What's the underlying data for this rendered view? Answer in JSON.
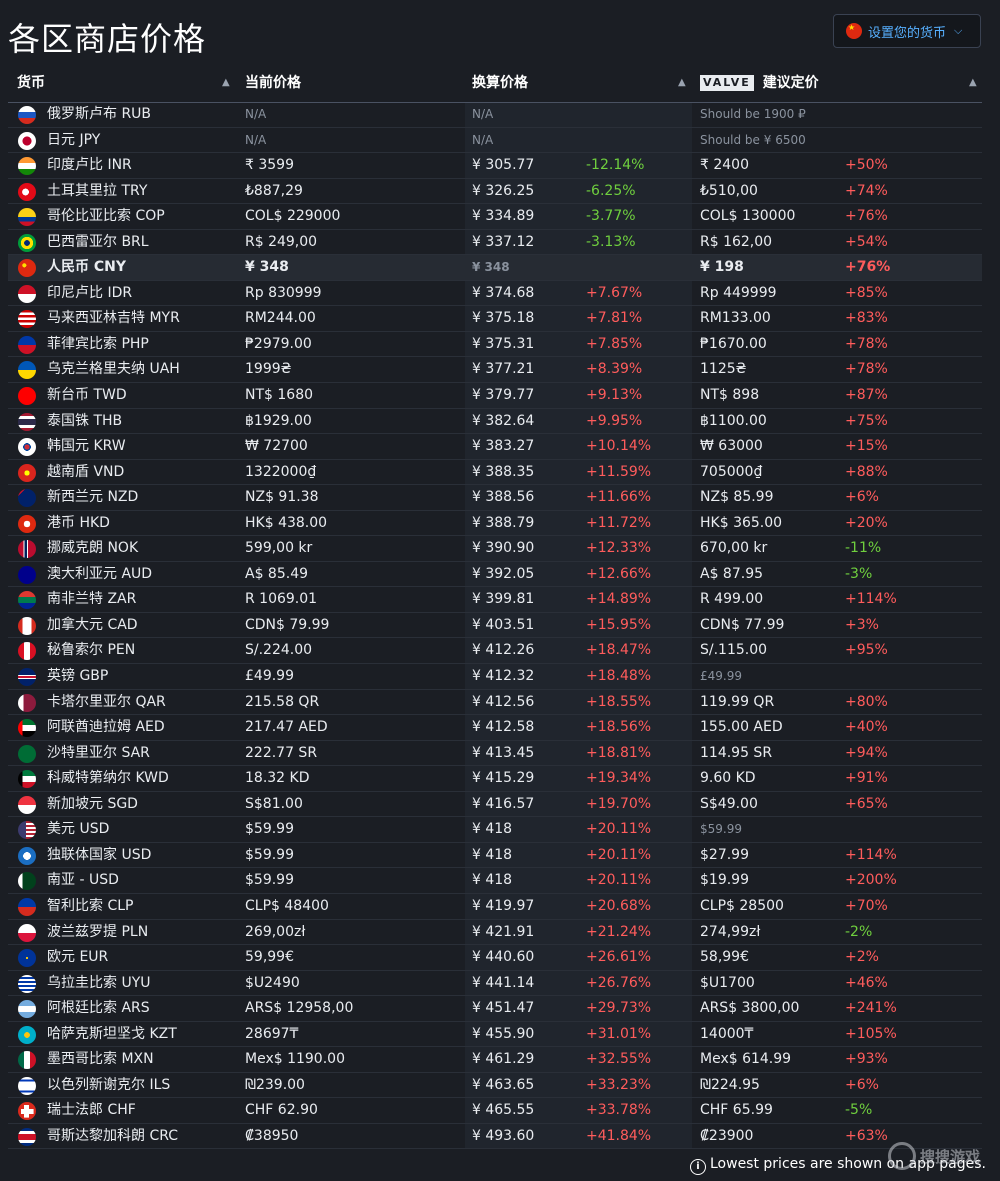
{
  "page": {
    "title": "各区商店价格",
    "currency_button": "设置您的货币",
    "footer": "Lowest prices are shown on app pages.",
    "watermark": "搜搜游戏"
  },
  "headers": {
    "currency": "货币",
    "current_price": "当前价格",
    "converted_price": "换算价格",
    "valve_logo": "VALVE",
    "suggested_price": "建议定价"
  },
  "colors": {
    "background": "#1b1e24",
    "positive": "#ff5c5c",
    "negative": "#6fcf3e",
    "accent": "#57b0ff"
  },
  "rows": [
    {
      "name": "俄罗斯卢布 RUB",
      "current": "N/A",
      "converted": "N/A",
      "diff": "",
      "suggested": "Should be 1900 ₽",
      "sdiff": "",
      "flag": "ru"
    },
    {
      "name": "日元 JPY",
      "current": "N/A",
      "converted": "N/A",
      "diff": "",
      "suggested": "Should be ¥ 6500",
      "sdiff": "",
      "flag": "jp"
    },
    {
      "name": "印度卢比 INR",
      "current": "₹ 3599",
      "converted": "¥ 305.77",
      "diff": "-12.14%",
      "suggested": "₹ 2400",
      "sdiff": "+50%",
      "flag": "in"
    },
    {
      "name": "土耳其里拉 TRY",
      "current": "₺887,29",
      "converted": "¥ 326.25",
      "diff": "-6.25%",
      "suggested": "₺510,00",
      "sdiff": "+74%",
      "flag": "tr"
    },
    {
      "name": "哥伦比亚比索 COP",
      "current": "COL$ 229000",
      "converted": "¥ 334.89",
      "diff": "-3.77%",
      "suggested": "COL$ 130000",
      "sdiff": "+76%",
      "flag": "co"
    },
    {
      "name": "巴西雷亚尔 BRL",
      "current": "R$ 249,00",
      "converted": "¥ 337.12",
      "diff": "-3.13%",
      "suggested": "R$ 162,00",
      "sdiff": "+54%",
      "flag": "br"
    },
    {
      "name": "人民币 CNY",
      "current": "¥ 348",
      "converted": "¥ 348",
      "diff": "",
      "suggested": "¥ 198",
      "sdiff": "+76%",
      "flag": "cn",
      "highlight": true
    },
    {
      "name": "印尼卢比 IDR",
      "current": "Rp 830999",
      "converted": "¥ 374.68",
      "diff": "+7.67%",
      "suggested": "Rp 449999",
      "sdiff": "+85%",
      "flag": "id"
    },
    {
      "name": "马来西亚林吉特 MYR",
      "current": "RM244.00",
      "converted": "¥ 375.18",
      "diff": "+7.81%",
      "suggested": "RM133.00",
      "sdiff": "+83%",
      "flag": "my"
    },
    {
      "name": "菲律宾比索 PHP",
      "current": "₱2979.00",
      "converted": "¥ 375.31",
      "diff": "+7.85%",
      "suggested": "₱1670.00",
      "sdiff": "+78%",
      "flag": "ph"
    },
    {
      "name": "乌克兰格里夫纳 UAH",
      "current": "1999₴",
      "converted": "¥ 377.21",
      "diff": "+8.39%",
      "suggested": "1125₴",
      "sdiff": "+78%",
      "flag": "ua"
    },
    {
      "name": "新台币 TWD",
      "current": "NT$ 1680",
      "converted": "¥ 379.77",
      "diff": "+9.13%",
      "suggested": "NT$ 898",
      "sdiff": "+87%",
      "flag": "tw"
    },
    {
      "name": "泰国铢 THB",
      "current": "฿1929.00",
      "converted": "¥ 382.64",
      "diff": "+9.95%",
      "suggested": "฿1100.00",
      "sdiff": "+75%",
      "flag": "th"
    },
    {
      "name": "韩国元 KRW",
      "current": "₩ 72700",
      "converted": "¥ 383.27",
      "diff": "+10.14%",
      "suggested": "₩ 63000",
      "sdiff": "+15%",
      "flag": "kr"
    },
    {
      "name": "越南盾 VND",
      "current": "1322000₫",
      "converted": "¥ 388.35",
      "diff": "+11.59%",
      "suggested": "705000₫",
      "sdiff": "+88%",
      "flag": "vn"
    },
    {
      "name": "新西兰元 NZD",
      "current": "NZ$ 91.38",
      "converted": "¥ 388.56",
      "diff": "+11.66%",
      "suggested": "NZ$ 85.99",
      "sdiff": "+6%",
      "flag": "nz"
    },
    {
      "name": "港币 HKD",
      "current": "HK$ 438.00",
      "converted": "¥ 388.79",
      "diff": "+11.72%",
      "suggested": "HK$ 365.00",
      "sdiff": "+20%",
      "flag": "hk"
    },
    {
      "name": "挪威克朗 NOK",
      "current": "599,00 kr",
      "converted": "¥ 390.90",
      "diff": "+12.33%",
      "suggested": "670,00 kr",
      "sdiff": "-11%",
      "flag": "no"
    },
    {
      "name": "澳大利亚元 AUD",
      "current": "A$ 85.49",
      "converted": "¥ 392.05",
      "diff": "+12.66%",
      "suggested": "A$ 87.95",
      "sdiff": "-3%",
      "flag": "au"
    },
    {
      "name": "南非兰特 ZAR",
      "current": "R 1069.01",
      "converted": "¥ 399.81",
      "diff": "+14.89%",
      "suggested": "R 499.00",
      "sdiff": "+114%",
      "flag": "za"
    },
    {
      "name": "加拿大元 CAD",
      "current": "CDN$ 79.99",
      "converted": "¥ 403.51",
      "diff": "+15.95%",
      "suggested": "CDN$ 77.99",
      "sdiff": "+3%",
      "flag": "ca"
    },
    {
      "name": "秘鲁索尔 PEN",
      "current": "S/.224.00",
      "converted": "¥ 412.26",
      "diff": "+18.47%",
      "suggested": "S/.115.00",
      "sdiff": "+95%",
      "flag": "pe"
    },
    {
      "name": "英镑 GBP",
      "current": "£49.99",
      "converted": "¥ 412.32",
      "diff": "+18.48%",
      "suggested": "£49.99",
      "sdiff": "",
      "flag": "gb",
      "smuted": true
    },
    {
      "name": "卡塔尔里亚尔 QAR",
      "current": "215.58 QR",
      "converted": "¥ 412.56",
      "diff": "+18.55%",
      "suggested": "119.99 QR",
      "sdiff": "+80%",
      "flag": "qa"
    },
    {
      "name": "阿联酋迪拉姆 AED",
      "current": "217.47 AED",
      "converted": "¥ 412.58",
      "diff": "+18.56%",
      "suggested": "155.00 AED",
      "sdiff": "+40%",
      "flag": "ae"
    },
    {
      "name": "沙特里亚尔 SAR",
      "current": "222.77 SR",
      "converted": "¥ 413.45",
      "diff": "+18.81%",
      "suggested": "114.95 SR",
      "sdiff": "+94%",
      "flag": "sa"
    },
    {
      "name": "科威特第纳尔 KWD",
      "current": "18.32 KD",
      "converted": "¥ 415.29",
      "diff": "+19.34%",
      "suggested": "9.60 KD",
      "sdiff": "+91%",
      "flag": "kw"
    },
    {
      "name": "新加坡元 SGD",
      "current": "S$81.00",
      "converted": "¥ 416.57",
      "diff": "+19.70%",
      "suggested": "S$49.00",
      "sdiff": "+65%",
      "flag": "sg"
    },
    {
      "name": "美元 USD",
      "current": "$59.99",
      "converted": "¥ 418",
      "diff": "+20.11%",
      "suggested": "$59.99",
      "sdiff": "",
      "flag": "us",
      "smuted": true
    },
    {
      "name": "独联体国家 USD",
      "current": "$59.99",
      "converted": "¥ 418",
      "diff": "+20.11%",
      "suggested": "$27.99",
      "sdiff": "+114%",
      "flag": "cis"
    },
    {
      "name": "南亚 - USD",
      "current": "$59.99",
      "converted": "¥ 418",
      "diff": "+20.11%",
      "suggested": "$19.99",
      "sdiff": "+200%",
      "flag": "pk"
    },
    {
      "name": "智利比索 CLP",
      "current": "CLP$ 48400",
      "converted": "¥ 419.97",
      "diff": "+20.68%",
      "suggested": "CLP$ 28500",
      "sdiff": "+70%",
      "flag": "cl"
    },
    {
      "name": "波兰兹罗提 PLN",
      "current": "269,00zł",
      "converted": "¥ 421.91",
      "diff": "+21.24%",
      "suggested": "274,99zł",
      "sdiff": "-2%",
      "flag": "pl"
    },
    {
      "name": "欧元 EUR",
      "current": "59,99€",
      "converted": "¥ 440.60",
      "diff": "+26.61%",
      "suggested": "58,99€",
      "sdiff": "+2%",
      "flag": "eu"
    },
    {
      "name": "乌拉圭比索 UYU",
      "current": "$U2490",
      "converted": "¥ 441.14",
      "diff": "+26.76%",
      "suggested": "$U1700",
      "sdiff": "+46%",
      "flag": "uy"
    },
    {
      "name": "阿根廷比索 ARS",
      "current": "ARS$ 12958,00",
      "converted": "¥ 451.47",
      "diff": "+29.73%",
      "suggested": "ARS$ 3800,00",
      "sdiff": "+241%",
      "flag": "ar"
    },
    {
      "name": "哈萨克斯坦坚戈 KZT",
      "current": "28697₸",
      "converted": "¥ 455.90",
      "diff": "+31.01%",
      "suggested": "14000₸",
      "sdiff": "+105%",
      "flag": "kz"
    },
    {
      "name": "墨西哥比索 MXN",
      "current": "Mex$ 1190.00",
      "converted": "¥ 461.29",
      "diff": "+32.55%",
      "suggested": "Mex$ 614.99",
      "sdiff": "+93%",
      "flag": "mx"
    },
    {
      "name": "以色列新谢克尔 ILS",
      "current": "₪239.00",
      "converted": "¥ 463.65",
      "diff": "+33.23%",
      "suggested": "₪224.95",
      "sdiff": "+6%",
      "flag": "il"
    },
    {
      "name": "瑞士法郎 CHF",
      "current": "CHF 62.90",
      "converted": "¥ 465.55",
      "diff": "+33.78%",
      "suggested": "CHF 65.99",
      "sdiff": "-5%",
      "flag": "ch"
    },
    {
      "name": "哥斯达黎加科朗 CRC",
      "current": "₡38950",
      "converted": "¥ 493.60",
      "diff": "+41.84%",
      "suggested": "₡23900",
      "sdiff": "+63%",
      "flag": "cr"
    }
  ]
}
